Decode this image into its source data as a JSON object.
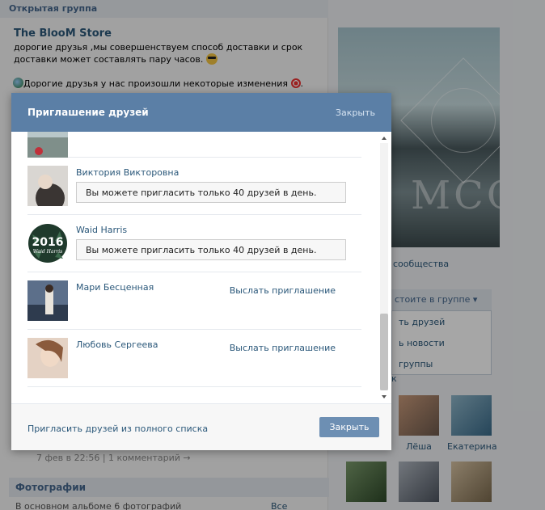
{
  "background": {
    "section_header": "Открытая группа",
    "group_title": "The BlooM Store",
    "group_description": "дорогие друзья ,мы совершенствуем способ доставки и срок доставки может составлять пару часов.",
    "news_line": "Дорогие друзья у нас произошли некоторые изменения",
    "post_date": "7 фев в 22:56",
    "post_comments": "1 комментарий →",
    "photos_header": "Фотографии",
    "photos_sub": "В основном альбоме 6 фотографий",
    "photos_link": "Все альбомы",
    "community_link": "сообщества",
    "member_button": "стоите в группе",
    "member_menu": [
      "ть друзей",
      "ь новости",
      "группы"
    ],
    "friends_k": "к",
    "friends_names": [
      "Лёша",
      "Екатерина"
    ]
  },
  "modal": {
    "title": "Приглашение друзей",
    "close_link": "Закрыть",
    "rows": [
      {
        "name": "Виктория Викторовна",
        "note": "Вы можете пригласить только 40 друзей в день."
      },
      {
        "name": "Waid Harris",
        "note": "Вы можете пригласить только 40 друзей в день."
      },
      {
        "name": "Мари Бесценная",
        "invite": "Выслать приглашение"
      },
      {
        "name": "Любовь Сергеева",
        "invite": "Выслать приглашение"
      }
    ],
    "waid_avatar_year": "2016",
    "waid_avatar_script": "Waid Harris",
    "footer_link": "Пригласить друзей из полного списка",
    "footer_button": "Закрыть"
  },
  "colors": {
    "header_bg": "#5b7fa6",
    "link": "#2b587a",
    "button_bg": "#6d8fb3"
  }
}
